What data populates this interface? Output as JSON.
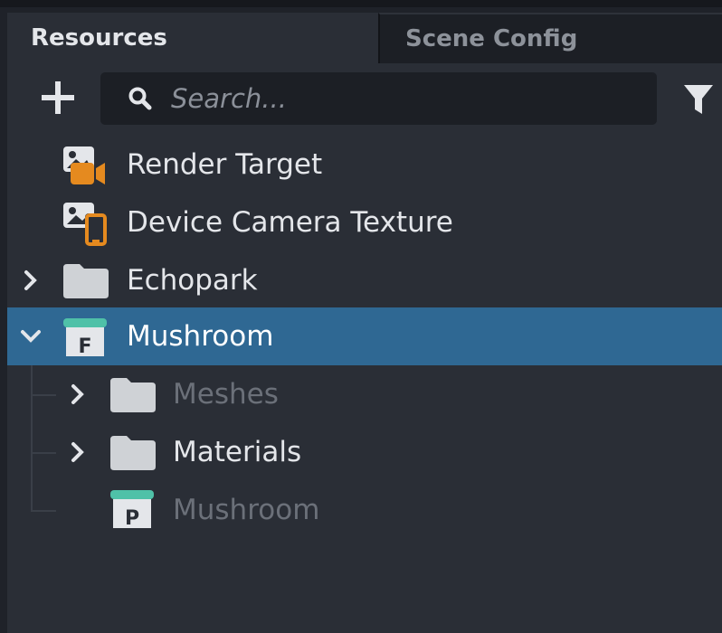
{
  "tabs": [
    {
      "label": "Resources",
      "active": true
    },
    {
      "label": "Scene Config",
      "active": false
    }
  ],
  "toolbar": {
    "search_placeholder": "Search...",
    "search_value": "",
    "add_icon": "plus-icon",
    "search_icon": "magnifier-icon",
    "filter_icon": "funnel-icon"
  },
  "tree": {
    "items": [
      {
        "label": "Render Target",
        "icon": "render-target-icon",
        "depth": 0
      },
      {
        "label": "Device Camera Texture",
        "icon": "device-camera-texture-icon",
        "depth": 0
      },
      {
        "label": "Echopark",
        "icon": "folder-icon",
        "depth": 0,
        "expandable": true,
        "expanded": false
      },
      {
        "label": "Mushroom",
        "icon": "fbx-icon",
        "icon_letter": "F",
        "depth": 0,
        "expandable": true,
        "expanded": true,
        "selected": true
      },
      {
        "label": "Meshes",
        "icon": "folder-icon",
        "depth": 1,
        "expandable": true,
        "expanded": false,
        "dimmed": true
      },
      {
        "label": "Materials",
        "icon": "folder-icon",
        "depth": 1,
        "expandable": true,
        "expanded": false
      },
      {
        "label": "Mushroom",
        "icon": "prefab-icon",
        "icon_letter": "P",
        "depth": 1,
        "dimmed": true
      }
    ]
  },
  "colors": {
    "background": "#2a2e36",
    "selected_row": "#2f6893",
    "accent_orange": "#e58a1f",
    "accent_teal": "#4fc1a8",
    "text": "#e4e6ea",
    "text_dimmed": "#6b7079"
  }
}
